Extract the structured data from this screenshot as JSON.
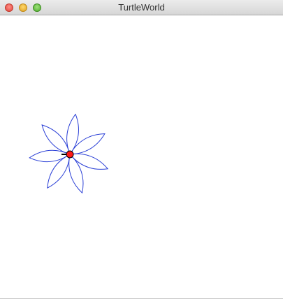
{
  "window": {
    "title": "TurtleWorld"
  },
  "drawing": {
    "shape": "flower",
    "petal_count": 7,
    "stroke_color": "#2a3fd6",
    "turtle_color": "#ff1a1a",
    "turtle_outline": "#000000"
  },
  "console": {
    "partial_text": ""
  },
  "icons": {
    "close": "close-icon",
    "minimize": "minimize-icon",
    "zoom": "zoom-icon",
    "turtle": "turtle-icon"
  }
}
